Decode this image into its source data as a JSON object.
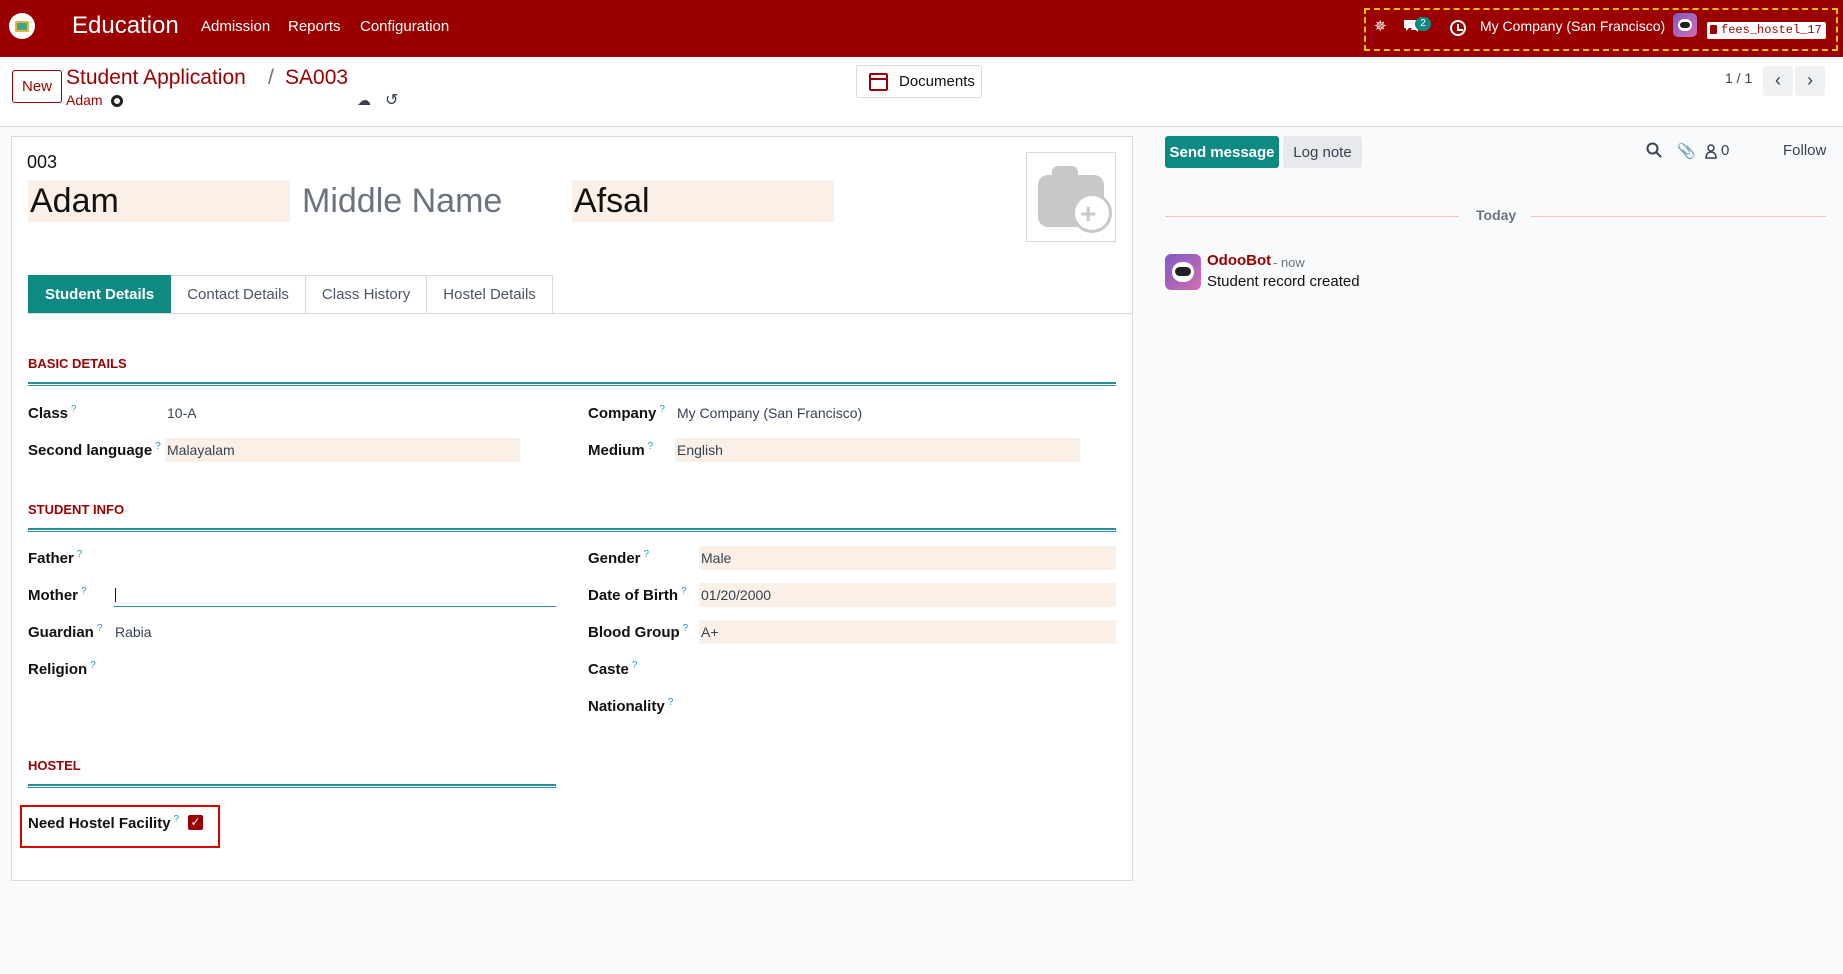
{
  "topbar": {
    "app_name": "Education",
    "menu": [
      "Admission",
      "Reports",
      "Configuration"
    ],
    "messages_badge": "2",
    "company": "My Company (San Francisco)",
    "database": "fees_hostel_17",
    "accent_color": "#9b0000"
  },
  "control": {
    "new_label": "New",
    "breadcrumb_parent": "Student Application",
    "breadcrumb_sep": "/",
    "breadcrumb_current": "SA003",
    "breadcrumb_sub": "Adam",
    "documents_label": "Documents",
    "pager": "1 / 1",
    "prev_icon": "‹",
    "next_icon": "›"
  },
  "form": {
    "reference": "003",
    "first_name": "Adam",
    "middle_name_placeholder": "Middle Name",
    "last_name": "Afsal",
    "tabs": [
      "Student Details",
      "Contact Details",
      "Class History",
      "Hostel Details"
    ],
    "basic": {
      "title": "BASIC DETAILS",
      "class_label": "Class",
      "class_value": "10-A",
      "second_language_label": "Second language",
      "second_language_value": "Malayalam",
      "company_label": "Company",
      "company_value": "My Company (San Francisco)",
      "medium_label": "Medium",
      "medium_value": "English"
    },
    "student_info": {
      "title": "STUDENT INFO",
      "father_label": "Father",
      "mother_label": "Mother",
      "guardian_label": "Guardian",
      "guardian_value": "Rabia",
      "religion_label": "Religion",
      "gender_label": "Gender",
      "gender_value": "Male",
      "dob_label": "Date of Birth",
      "dob_value": "01/20/2000",
      "blood_label": "Blood Group",
      "blood_value": "A+",
      "caste_label": "Caste",
      "nationality_label": "Nationality"
    },
    "hostel": {
      "title": "HOSTEL",
      "need_label": "Need Hostel Facility",
      "need_checked": true
    },
    "help_mark": "?"
  },
  "chatter": {
    "send_label": "Send message",
    "log_label": "Log note",
    "followers_count": "0",
    "follow_label": "Follow",
    "date_divider": "Today",
    "messages": [
      {
        "author": "OdooBot",
        "when": "- now",
        "body": "Student record created"
      }
    ]
  }
}
